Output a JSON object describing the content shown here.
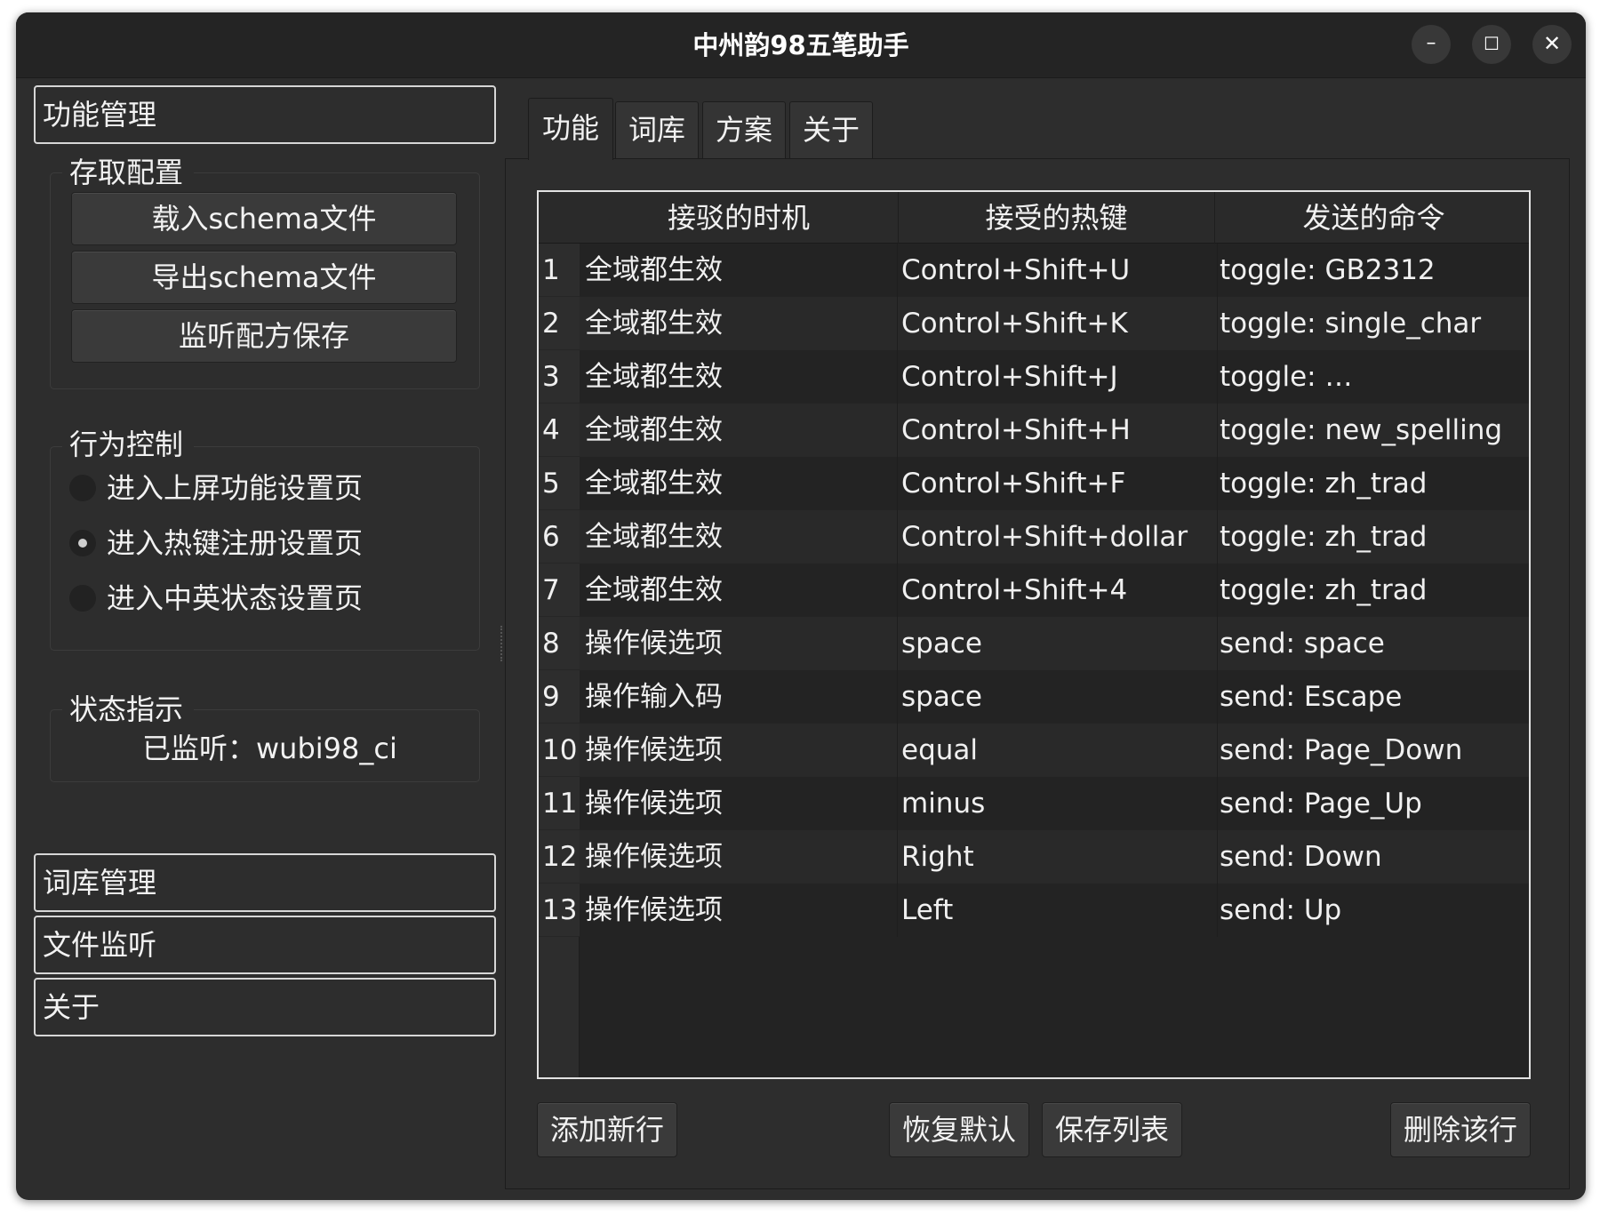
{
  "window": {
    "title": "中州韵98五笔助手",
    "controls": {
      "minimize": "–",
      "maximize": "☐",
      "close": "✕"
    }
  },
  "sidebar": {
    "function_mgmt": "功能管理",
    "config_group": {
      "title": "存取配置",
      "buttons": [
        "载入schema文件",
        "导出schema文件",
        "监听配方保存"
      ]
    },
    "behavior_group": {
      "title": "行为控制",
      "options": [
        {
          "label": "进入上屏功能设置页",
          "checked": false
        },
        {
          "label": "进入热键注册设置页",
          "checked": true
        },
        {
          "label": "进入中英状态设置页",
          "checked": false
        }
      ]
    },
    "status_group": {
      "title": "状态指示",
      "text": "已监听：wubi98_ci"
    },
    "dict_mgmt": "词库管理",
    "file_watch": "文件监听",
    "about": "关于"
  },
  "tabs": [
    "功能",
    "词库",
    "方案",
    "关于"
  ],
  "active_tab": 0,
  "table": {
    "headers": [
      "接驳的时机",
      "接受的热键",
      "发送的命令"
    ],
    "rows": [
      [
        "1",
        "全域都生效",
        "Control+Shift+U",
        "toggle: GB2312"
      ],
      [
        "2",
        "全域都生效",
        "Control+Shift+K",
        "toggle: single_char"
      ],
      [
        "3",
        "全域都生效",
        "Control+Shift+J",
        "toggle: …"
      ],
      [
        "4",
        "全域都生效",
        "Control+Shift+H",
        "toggle: new_spelling"
      ],
      [
        "5",
        "全域都生效",
        "Control+Shift+F",
        "toggle: zh_trad"
      ],
      [
        "6",
        "全域都生效",
        "Control+Shift+dollar",
        "toggle: zh_trad"
      ],
      [
        "7",
        "全域都生效",
        "Control+Shift+4",
        "toggle: zh_trad"
      ],
      [
        "8",
        "操作候选项",
        "space",
        "send: space"
      ],
      [
        "9",
        "操作输入码",
        "space",
        "send: Escape"
      ],
      [
        "10",
        "操作候选项",
        "equal",
        "send: Page_Down"
      ],
      [
        "11",
        "操作候选项",
        "minus",
        "send: Page_Up"
      ],
      [
        "12",
        "操作候选项",
        "Right",
        "send: Down"
      ],
      [
        "13",
        "操作候选项",
        "Left",
        "send: Up"
      ]
    ]
  },
  "actions": {
    "add_row": "添加新行",
    "restore_default": "恢复默认",
    "save_list": "保存列表",
    "delete_row": "删除该行"
  }
}
